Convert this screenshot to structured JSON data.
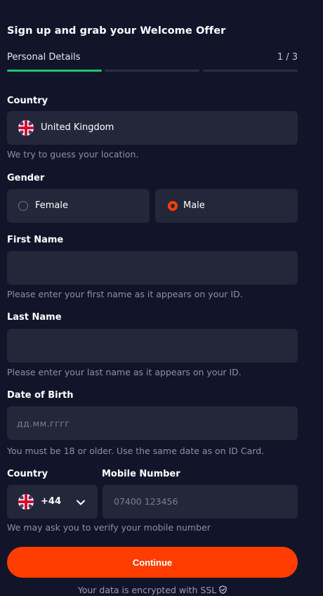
{
  "header": {
    "title": "Sign up and grab your Welcome Offer",
    "step_label": "Personal Details",
    "step_count": "1 / 3",
    "progress_fraction": 0.333
  },
  "country": {
    "label": "Country",
    "value": "United Kingdom",
    "flag_icon": "uk-flag-icon",
    "hint": "We try to guess your location."
  },
  "gender": {
    "label": "Gender",
    "options": [
      {
        "label": "Female",
        "selected": false
      },
      {
        "label": "Male",
        "selected": true
      }
    ],
    "accent": "#ff3d00"
  },
  "first_name": {
    "label": "First Name",
    "value": "",
    "hint": "Please enter your first name as it appears on your ID."
  },
  "last_name": {
    "label": "Last Name",
    "value": "",
    "hint": "Please enter your last name as it appears on your ID."
  },
  "dob": {
    "label": "Date of Birth",
    "placeholder": "дд.мм.гггг",
    "hint": "You must be 18 or older. Use the same date as on ID Card."
  },
  "phone": {
    "country_label": "Country",
    "number_label": "Mobile Number",
    "dial_code": "+44",
    "placeholder": "07400 123456",
    "hint": "We may ask you to verify your mobile number"
  },
  "continue_label": "Continue",
  "footer_text": "Your data is encrypted with SSL",
  "colors": {
    "background": "#12152a",
    "field": "#24273a",
    "progress_active": "#1fc56e",
    "button": "#ff3d00"
  }
}
